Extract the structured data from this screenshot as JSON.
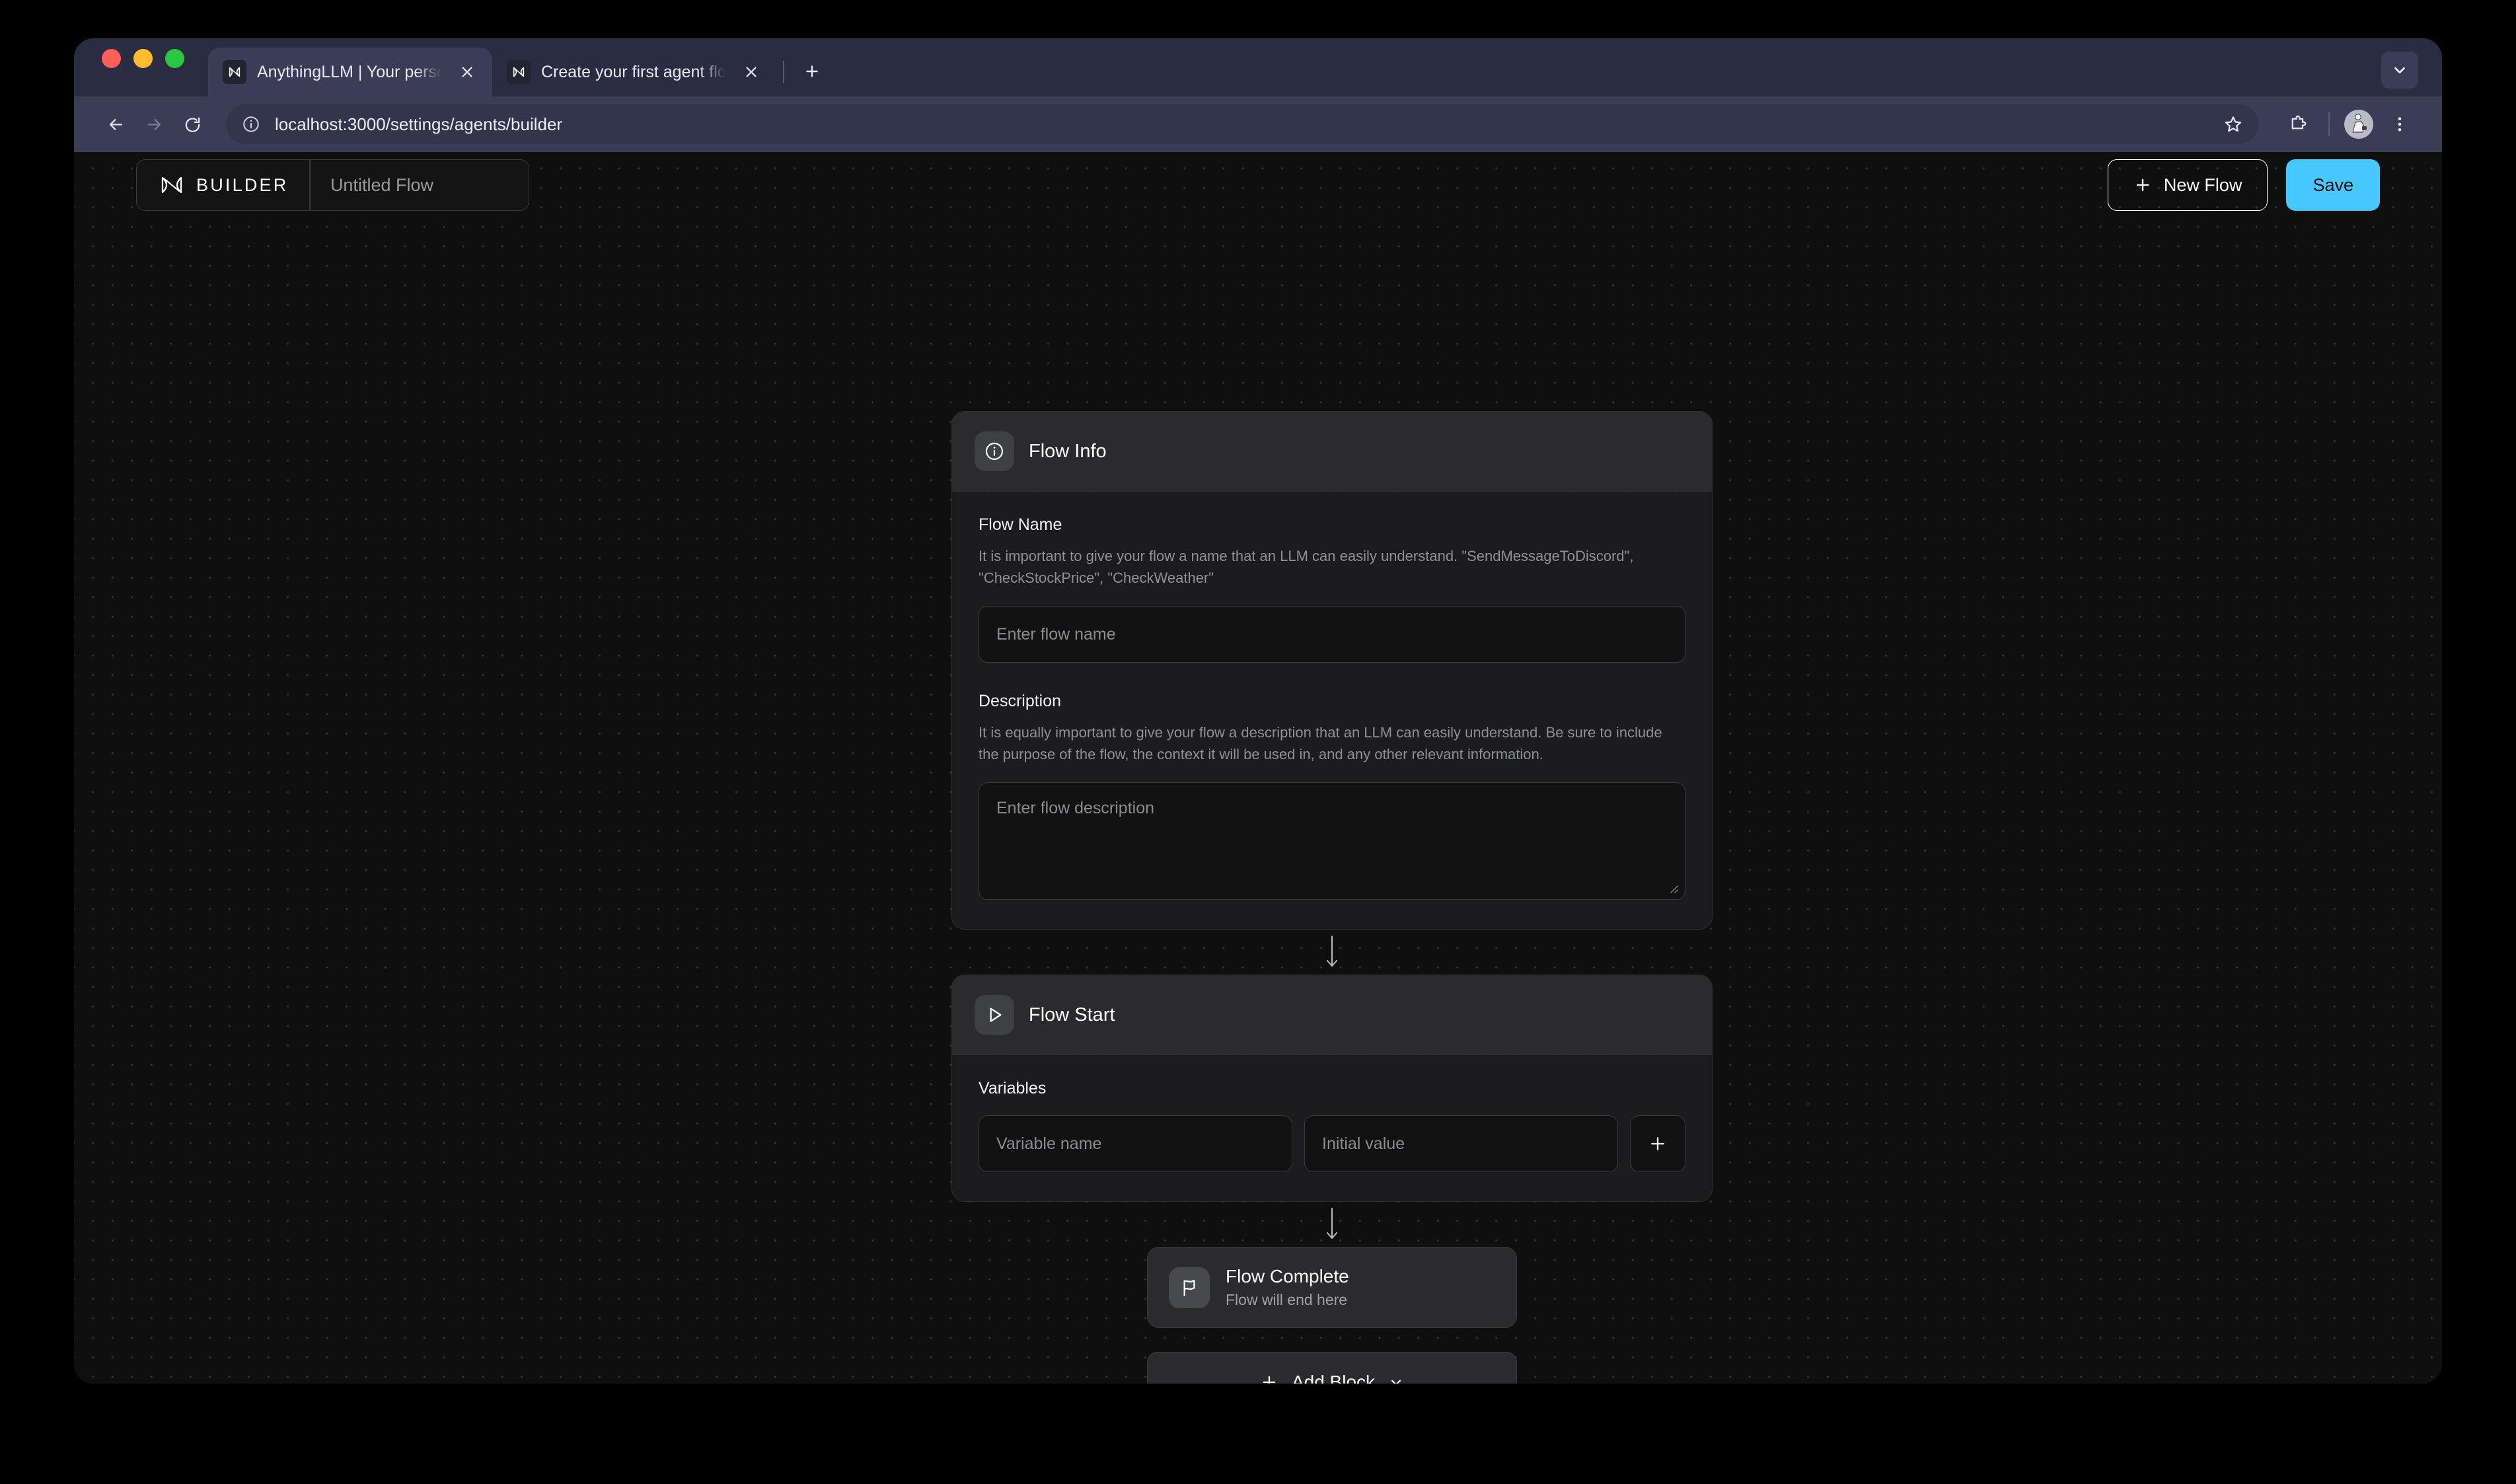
{
  "browser": {
    "tabs": [
      {
        "title": "AnythingLLM | Your personal",
        "active": true,
        "favicon": "anythingllm-icon"
      },
      {
        "title": "Create your first agent flow ~",
        "active": false,
        "favicon": "anythingllm-icon"
      }
    ],
    "new_tab_label": "+",
    "url": "localhost:3000/settings/agents/builder",
    "icons": {
      "back": "back-arrow-icon",
      "forward": "forward-arrow-icon",
      "reload": "reload-icon",
      "site_info": "site-info-icon",
      "bookmark": "star-icon",
      "extensions": "puzzle-icon",
      "profile": "avatar",
      "menu": "kebab-menu-icon",
      "tab_list": "chevron-down-icon"
    }
  },
  "app": {
    "brand": "BUILDER",
    "flow_title": "Untitled Flow",
    "new_flow_label": "New Flow",
    "save_label": "Save",
    "accent_color": "#46c8ff"
  },
  "flow_info": {
    "header_title": "Flow Info",
    "name_label": "Flow Name",
    "name_hint": "It is important to give your flow a name that an LLM can easily understand. \"SendMessageToDiscord\", \"CheckStockPrice\", \"CheckWeather\"",
    "name_placeholder": "Enter flow name",
    "name_value": "",
    "description_label": "Description",
    "description_hint": "It is equally important to give your flow a description that an LLM can easily understand. Be sure to include the purpose of the flow, the context it will be used in, and any other relevant information.",
    "description_placeholder": "Enter flow description",
    "description_value": ""
  },
  "flow_start": {
    "header_title": "Flow Start",
    "variables_label": "Variables",
    "variable_name_placeholder": "Variable name",
    "variable_name_value": "",
    "initial_value_placeholder": "Initial value",
    "initial_value_value": "",
    "add_variable_label": "+"
  },
  "flow_complete": {
    "title": "Flow Complete",
    "subtitle": "Flow will end here"
  },
  "add_block": {
    "label": "Add Block"
  }
}
